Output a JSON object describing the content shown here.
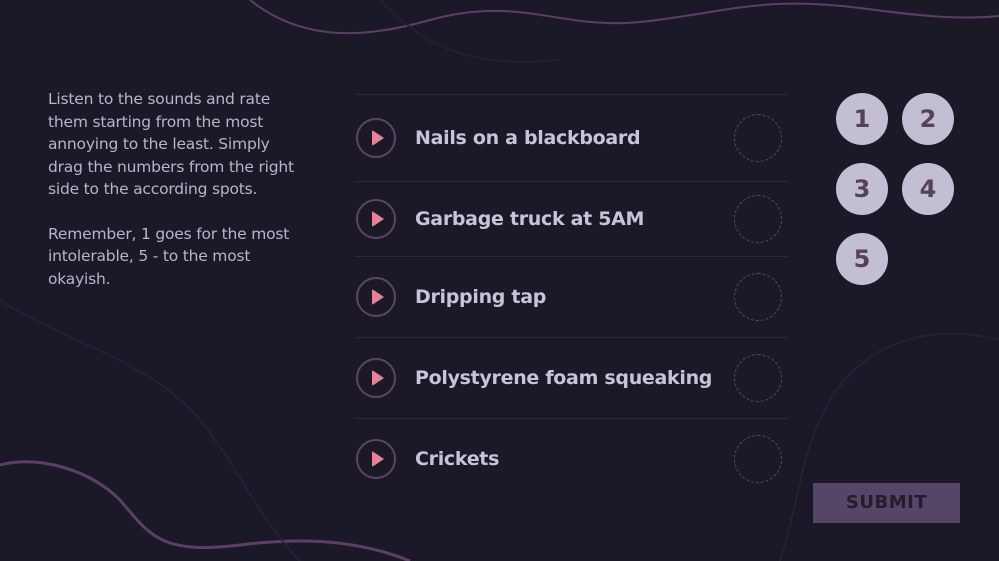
{
  "instructions": {
    "paragraph1": "Listen to the sounds and rate them starting from the most annoying to the least.  Simply drag the numbers from the right side to the according spots.",
    "paragraph2": "Remember, 1 goes for the most intolerable, 5 - to the most okayish."
  },
  "sounds": [
    {
      "label": "Nails on a blackboard"
    },
    {
      "label": "Garbage truck at 5AM"
    },
    {
      "label": "Dripping tap"
    },
    {
      "label": "Polystyrene foam squeaking"
    },
    {
      "label": "Crickets"
    }
  ],
  "tokens": [
    "1",
    "2",
    "3",
    "4",
    "5"
  ],
  "submit": {
    "label": "SUBMIT"
  },
  "icons": {
    "play": "play-icon"
  },
  "colors": {
    "background": "#1b1928",
    "accent": "#e8809c",
    "token": "#c2bfd4",
    "token_text": "#58405d",
    "submit_bg": "#554566"
  }
}
